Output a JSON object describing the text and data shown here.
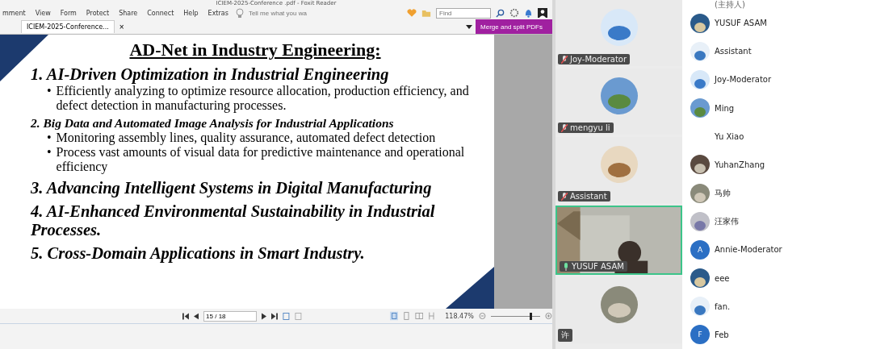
{
  "window": {
    "title": "ICIEM-2025-Conference .pdf - Foxit Reader"
  },
  "menu": [
    "mment",
    "View",
    "Form",
    "Protect",
    "Share",
    "Connect",
    "Help",
    "Extras"
  ],
  "tell_me": {
    "placeholder": "Tell me what you wa"
  },
  "find": {
    "placeholder": "Find"
  },
  "tab": {
    "label": "ICIEM-2025-Conference...",
    "close": "×"
  },
  "merge_button": "Merge and split PDFs",
  "slide": {
    "title": "AD-Net in Industry Engineering:",
    "sections": [
      {
        "number": "1.",
        "title": "AI-Driven Optimization in Industrial Engineering",
        "kind": "heading",
        "bullets": [
          {
            "marker": "•",
            "text": "Efficiently analyzing to optimize resource allocation, production efficiency, and defect detection in manufacturing processes."
          }
        ]
      },
      {
        "number": "2.",
        "title": "Big Data and Automated Image Analysis for Industrial Applications",
        "kind": "subheading",
        "bullets": [
          {
            "marker": "•",
            "text": "Monitoring assembly lines, quality assurance, automated defect detection"
          },
          {
            "marker": "•",
            "text": "Process vast amounts of visual data for predictive maintenance and operational efficiency"
          }
        ]
      },
      {
        "number": "3.",
        "title": "Advancing Intelligent Systems in Digital Manufacturing",
        "kind": "heading"
      },
      {
        "number": "4.",
        "title": "AI-Enhanced Environmental Sustainability in Industrial Processes.",
        "kind": "heading"
      },
      {
        "number": "5.",
        "title": "Cross-Domain Applications in Smart Industry.",
        "kind": "heading"
      }
    ]
  },
  "status_bar": {
    "page": "15 / 18",
    "zoom": "118.47%",
    "zoom_slider": {
      "level": 0.78
    }
  },
  "video_tiles": [
    {
      "name": "Joy-Moderator",
      "kind": "avatar",
      "muted": true,
      "speaking": false
    },
    {
      "name": "mengyu li",
      "kind": "avatar",
      "muted": true,
      "speaking": false
    },
    {
      "name": "Assistant",
      "kind": "avatar",
      "muted": true,
      "speaking": false
    },
    {
      "name": "YUSUF ASAM",
      "kind": "video",
      "muted": false,
      "speaking": true
    },
    {
      "name": "许",
      "kind": "avatar",
      "muted": false,
      "speaking": false
    }
  ],
  "host_label": "(主持人)",
  "participants": [
    {
      "name": "YUSUF ASAM"
    },
    {
      "name": "Assistant"
    },
    {
      "name": "Joy-Moderator"
    },
    {
      "name": "Ming"
    },
    {
      "name": "Yu Xiao",
      "kind": "blank"
    },
    {
      "name": "YuhanZhang"
    },
    {
      "name": "马帅"
    },
    {
      "name": "汪家伟"
    },
    {
      "name": "Annie-Moderator",
      "kind": "letter",
      "letter": "A"
    },
    {
      "name": "eee"
    },
    {
      "name": "fan."
    },
    {
      "name": "Feb",
      "kind": "letter",
      "letter": "F"
    }
  ]
}
